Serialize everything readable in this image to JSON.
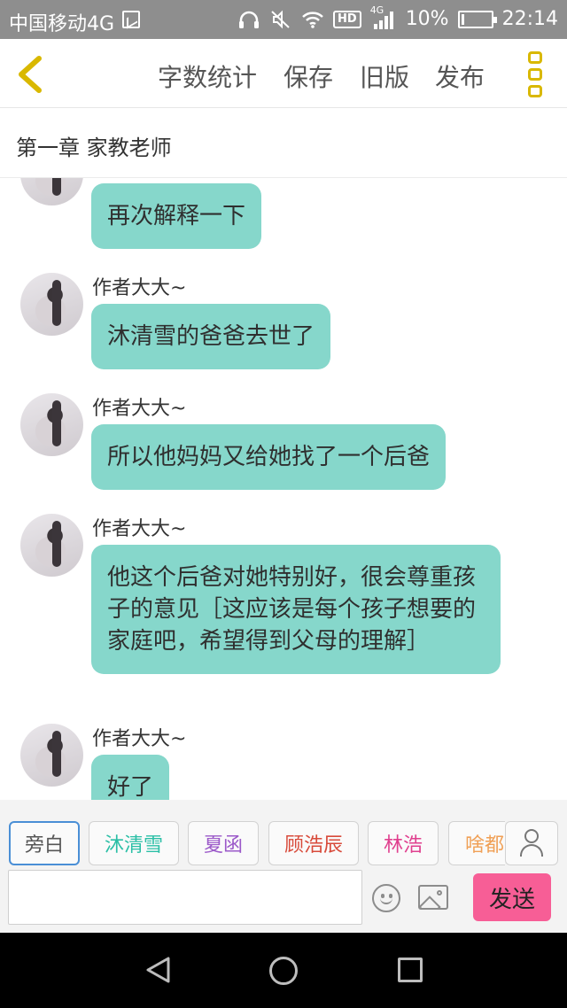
{
  "status_bar": {
    "carrier": "中国移动4G",
    "network_small": "4G",
    "hd_label": "HD",
    "battery_percent": "10%",
    "battery_level": 0.1,
    "time": "22:14"
  },
  "toolbar": {
    "word_count": "字数统计",
    "save": "保存",
    "old_version": "旧版",
    "publish": "发布"
  },
  "chapter": {
    "title": "第一章 家教老师"
  },
  "messages": [
    {
      "author": "",
      "text": "再次解释一下"
    },
    {
      "author": "作者大大~",
      "text": "沐清雪的爸爸去世了"
    },
    {
      "author": "作者大大~",
      "text": "所以他妈妈又给她找了一个后爸"
    },
    {
      "author": "作者大大~",
      "text": "他这个后爸对她特别好，很会尊重孩子的意见［这应该是每个孩子想要的家庭吧，希望得到父母的理解］"
    },
    {
      "author": "作者大大~",
      "text": "好了"
    }
  ],
  "characters": [
    {
      "name": "旁白",
      "color": "#555555"
    },
    {
      "name": "沐清雪",
      "color": "#2bbfa6"
    },
    {
      "name": "夏函",
      "color": "#9b59c9"
    },
    {
      "name": "顾浩辰",
      "color": "#d84a3a"
    },
    {
      "name": "林浩",
      "color": "#e0408f"
    },
    {
      "name": "啥都",
      "color": "#f0a056"
    }
  ],
  "composer": {
    "value": "",
    "placeholder": "",
    "send_label": "发送"
  },
  "colors": {
    "bubble": "#86d7cb",
    "send_button": "#f75e96",
    "menu_accent": "#d9b800",
    "active_chip_border": "#4a8fd6"
  },
  "icons": {
    "back": "chevron-left-icon",
    "menu": "more-vertical-icon",
    "person": "user-icon",
    "emoji": "smiley-icon",
    "image": "image-icon"
  }
}
